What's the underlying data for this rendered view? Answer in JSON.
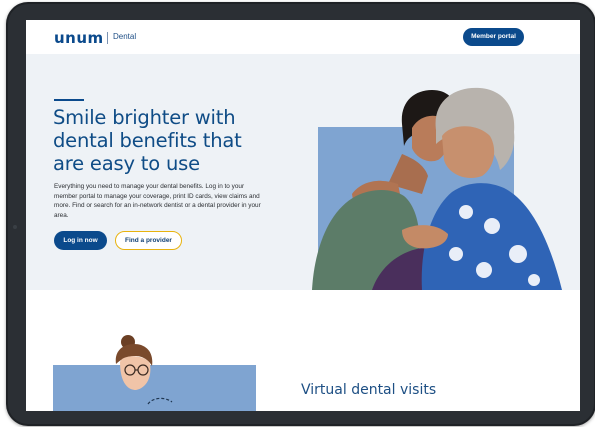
{
  "brand": {
    "logo_text": "unum",
    "sub_label": "Dental"
  },
  "header": {
    "member_portal_label": "Member portal"
  },
  "hero": {
    "headline": "Smile brighter with dental benefits that are easy to use",
    "body": "Everything you need to manage your dental benefits. Log in to your member portal to manage your coverage, print ID cards, view claims and more. Find or search for an in-network dentist or a dental provider in your area.",
    "login_label": "Log in now",
    "find_provider_label": "Find a provider"
  },
  "section2": {
    "title": "Virtual dental visits"
  },
  "colors": {
    "brand_navy": "#0b4a8c",
    "hero_bg": "#eef2f6",
    "accent_yellow": "#e8b30f",
    "photo_block": "#7fa4d1"
  }
}
